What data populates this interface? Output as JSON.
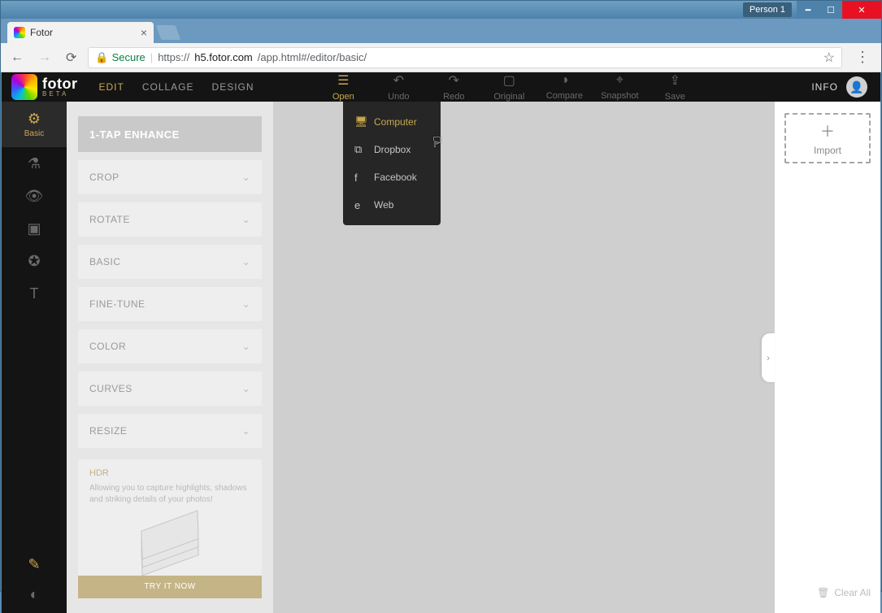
{
  "window": {
    "person_badge": "Person 1"
  },
  "browser": {
    "tab_title": "Fotor",
    "secure_label": "Secure",
    "url_scheme": "https://",
    "url_host": "h5.fotor.com",
    "url_path": "/app.html#/editor/basic/"
  },
  "header": {
    "brand": "fotor",
    "brand_sub": "BETA",
    "nav": {
      "edit": "EDIT",
      "collage": "COLLAGE",
      "design": "DESIGN"
    },
    "tools": {
      "open": "Open",
      "undo": "Undo",
      "redo": "Redo",
      "original": "Original",
      "compare": "Compare",
      "snapshot": "Snapshot",
      "save": "Save"
    },
    "info": "INFO"
  },
  "sidebar": {
    "basic_label": "Basic"
  },
  "panel": {
    "enhance": "1-TAP ENHANCE",
    "items": {
      "crop": "CROP",
      "rotate": "ROTATE",
      "basic": "BASIC",
      "finetune": "FINE-TUNE",
      "color": "COLOR",
      "curves": "CURVES",
      "resize": "RESIZE"
    },
    "hdr": {
      "title": "HDR",
      "desc": "Allowing you to capture highlights, shadows and striking details of your photos!",
      "cta": "TRY IT NOW"
    }
  },
  "open_menu": {
    "computer": "Computer",
    "dropbox": "Dropbox",
    "facebook": "Facebook",
    "web": "Web"
  },
  "right": {
    "import": "Import",
    "clear_all": "Clear All"
  }
}
